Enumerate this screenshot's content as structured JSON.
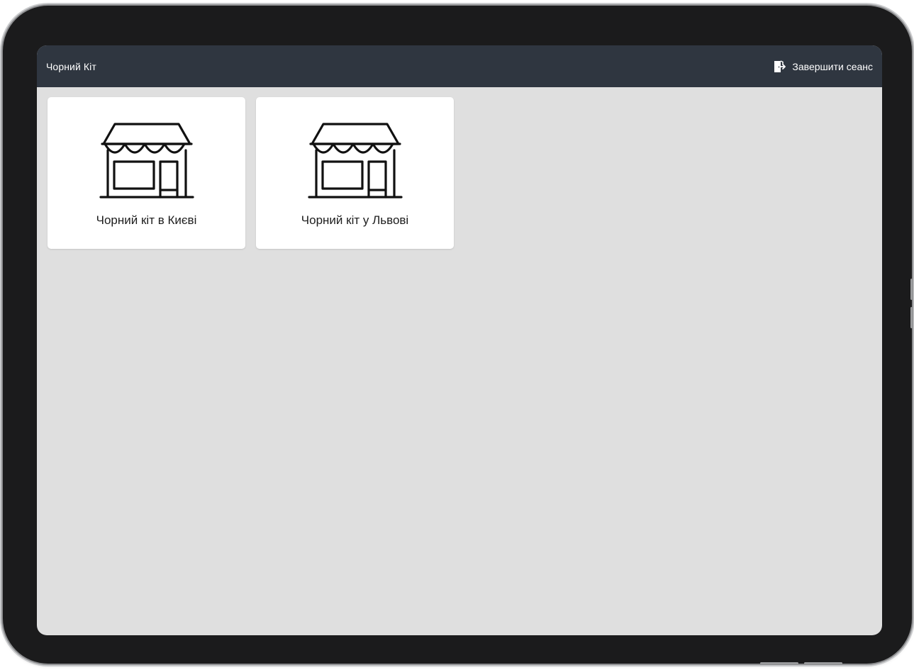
{
  "header": {
    "title": "Чорний Кіт",
    "logout_label": "Завершити сеанс"
  },
  "stores": [
    {
      "name": "Чорний кіт в Києві",
      "icon": "store-icon"
    },
    {
      "name": "Чорний кіт у Львові",
      "icon": "store-icon"
    }
  ],
  "colors": {
    "header_bg": "#2f3640",
    "screen_bg": "#dfdfdf",
    "card_bg": "#ffffff",
    "device_bezel": "#1b1b1c"
  }
}
